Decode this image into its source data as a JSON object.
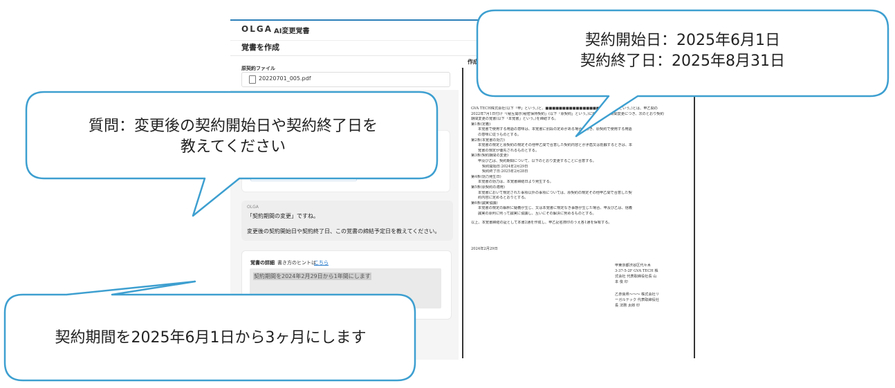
{
  "app": {
    "logo": "OLGA",
    "title": "AI変更覚書",
    "page_title": "覚書を作成"
  },
  "file": {
    "label": "原契約ファイル",
    "name": "20220701_005.pdf"
  },
  "chat": {
    "sender": "OLGA",
    "line1": "「契約期間の変更」ですね。",
    "line2": "変更後の契約開始日や契約終了日、この覚書の締結予定日を教えてください。"
  },
  "detail": {
    "label": "覚書の詳細",
    "hint": "書き方のヒントは",
    "link": "こちら",
    "text": "契約期間を2024年2月29日から1年間にします"
  },
  "document": {
    "tab": "作成",
    "lines": [
      "GVA TECH株式会社(以下「甲」という。)と、■■■■■■■■■■■■■■■■(以下「乙」という。)とは、甲乙間の",
      "2022年7月1日付け「(秘互開示)秘密保持契約」(以下「原契約」という。)に関し、契約期間変更につき、次のとおり契約",
      "期間変更の覚書(以下「本覚書」という。)を締結する。",
      "第1条(定義)",
      "本覚書で使用する用語の意味は、本覚書に別段の定めがある場合を除き、原契約で使用する用語",
      "の意味に従うものとする。",
      "第2条(本覚書の効力)",
      "本覚書の規定と原契約の規定その他甲乙間で合意した契約内容とが矛盾又は抵触するときは、本",
      "覚書の規定が優先されるものとする。",
      "第3条(契約期間の変更)",
      "甲及び乙は、契約期間について、以下のとおり変更することに合意する。",
      "契約開始日:2024年2月29日",
      "契約終了日:2025年2月28日",
      "第4条(効力発生日)",
      "本覚書の効力は、本覚書締結日より発生する。",
      "第5条(原契約の適用)",
      "本覚書において規定された事項以外の事項については、原契約の規定その他甲乙間で合意した契",
      "約内容に定めるとおりとする。",
      "第6条(誠実協議)",
      "本覚書の規定の解釈に疑義が生じ、又は本覚書に規定なき事態が生じた場合、甲及び乙は、信義",
      "誠実の原則に則って誠実に協議し、互いにその解決に努めるものとする。",
      "以上、本覚書締結の証として本書2通を作成し、甲乙記名捺印のうえ各1通を保有する。"
    ],
    "date": "2024年2月29日",
    "sig_a": [
      "甲東京都渋谷区代々木",
      "3-37-5-2F GVA TECH 株",
      "式会社 代表取締役社長 山",
      "本 俊 印"
    ],
    "sig_b": [
      "乙奈良県～～～ 株式会社リ",
      "ーガルテック 代表取締役社",
      "長 法務 太郎 印"
    ]
  },
  "callouts": {
    "top_line1": "契約開始日：2025年6月1日",
    "top_line2": "契約終了日：2025年8月31日",
    "left_line1": "質問：変更後の契約開始日や契約終了日を",
    "left_line2": "教えてください",
    "bottom": "契約期間を2025年6月1日から3ヶ月にします"
  },
  "colors": {
    "callout_border": "#3d9fd0",
    "link": "#1a73c9",
    "accent": "#2b7fb8"
  }
}
